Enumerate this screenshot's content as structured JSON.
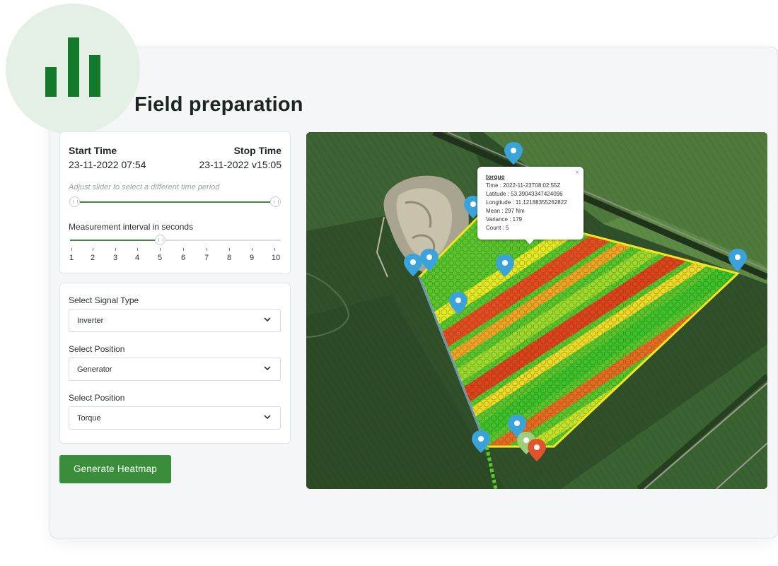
{
  "page": {
    "title": "Field preparation"
  },
  "time_panel": {
    "start_label": "Start Time",
    "start_value": "23-11-2022 07:54",
    "stop_label": "Stop Time",
    "stop_value": "23-11-2022 v15:05",
    "slider_hint": "Adjust slider to select a different time period",
    "interval_label": "Measurement interval in seconds",
    "interval_selected": 5,
    "interval_ticks": [
      "1",
      "2",
      "3",
      "4",
      "5",
      "6",
      "7",
      "8",
      "9",
      "10"
    ]
  },
  "filters": {
    "signal_type_label": "Select Signal Type",
    "signal_type_value": "Inverter",
    "position_label": "Select Position",
    "position_value": "Generator",
    "measure_label": "Select Position",
    "measure_value": "Torque"
  },
  "actions": {
    "generate_label": "Generate Heatmap"
  },
  "popup": {
    "title": "torque",
    "close": "×",
    "time": "Time : 2022-11-23T08:02:55Z",
    "latitude": "Latitude : 53.39043347424096",
    "longitude": "Longitude : 11.12188355262822",
    "mean": "Mean : 297 Nm",
    "variance": "Variance : 179",
    "count": "Count : 5"
  },
  "colors": {
    "accent": "#3a8d3a",
    "badge_bg": "#e4efe6",
    "badge_bars": "#137a2a",
    "marker_blue": "#3aa3dc",
    "marker_orange": "#e2532a"
  }
}
